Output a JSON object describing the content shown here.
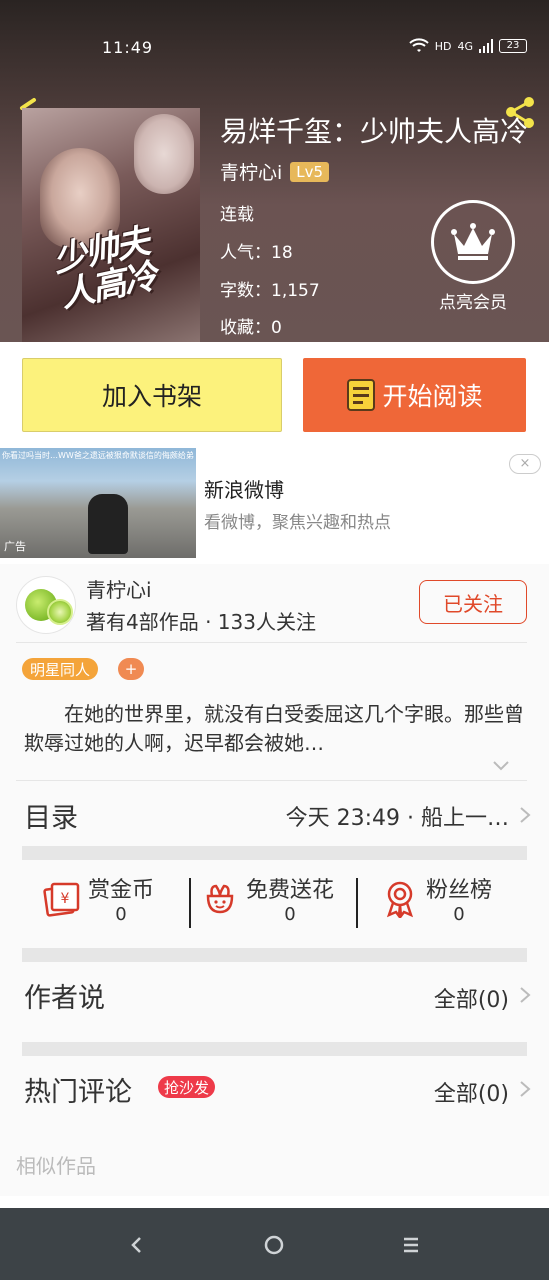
{
  "status": {
    "time": "11:49",
    "network": "4G",
    "hd": "HD",
    "battery": "23"
  },
  "book": {
    "title": "易烊千玺：少帅夫人高冷",
    "author": "青柠心i",
    "level": "Lv5",
    "status": "连载",
    "popularity": "人气：18",
    "words": "字数：1,157",
    "favorites": "收藏：0",
    "vip_label": "点亮会员",
    "cover_art_text": "少帅夫人高冷"
  },
  "buttons": {
    "shelf": "加入书架",
    "read": "开始阅读"
  },
  "ad": {
    "caption": "你看过吗当时…WW爸之遗远被狠命默谈信的侮颇给弟笑载了",
    "title": "新浪微博",
    "desc": "看微博，聚焦兴趣和热点",
    "tag": "广告",
    "close": "×"
  },
  "author_card": {
    "name": "青柠心i",
    "stats": "著有4部作品 · 133人关注",
    "follow": "已关注"
  },
  "tags": {
    "category": "明星同人",
    "add": "+"
  },
  "synopsis": "在她的世界里，就没有白受委屈这几个字眼。那些曾欺辱过她的人啊，迟早都会被她…",
  "toc": {
    "label": "目录",
    "latest": "今天  23:49   ·   船上一…"
  },
  "actions": [
    {
      "title": "赏金币",
      "count": "0",
      "icon": "coin-envelope-icon"
    },
    {
      "title": "免费送花",
      "count": "0",
      "icon": "flower-icon"
    },
    {
      "title": "粉丝榜",
      "count": "0",
      "icon": "medal-icon"
    }
  ],
  "author_says": {
    "title": "作者说",
    "all": "全部(0)"
  },
  "hot_comments": {
    "title": "热门评论",
    "badge": "抢沙发",
    "all": "全部(0)"
  },
  "similar": "相似作品",
  "colors": {
    "read_button": "#ef6738",
    "shelf_button": "#fcf27c",
    "follow": "#e0492a",
    "badge_red": "#ee3a49",
    "tag_orange": "#f4a43a"
  }
}
